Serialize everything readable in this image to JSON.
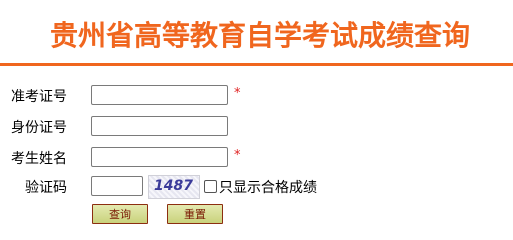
{
  "header": {
    "title": "贵州省高等教育自学考试成绩查询",
    "accent_color": "#f0661e"
  },
  "form": {
    "fields": [
      {
        "label": "准考证号",
        "value": "",
        "required": true
      },
      {
        "label": "身份证号",
        "value": "",
        "required": false
      },
      {
        "label": "考生姓名",
        "value": "",
        "required": true
      }
    ],
    "captcha": {
      "label": "验证码",
      "value": "",
      "image_text": "1487"
    },
    "checkbox": {
      "label": "只显示合格成绩",
      "checked": false
    },
    "required_mark": "*"
  },
  "buttons": {
    "query_label": "查询",
    "reset_label": "重置"
  }
}
